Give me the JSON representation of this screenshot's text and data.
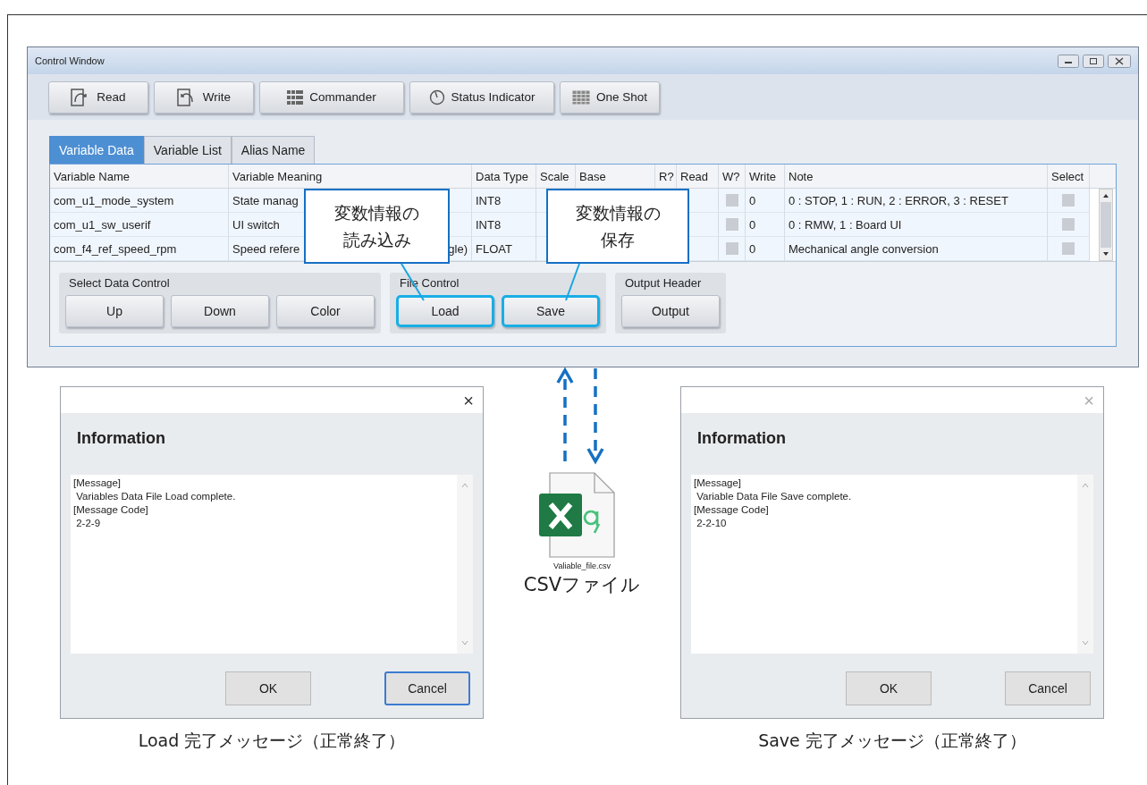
{
  "window": {
    "title": "Control Window",
    "toolbar": [
      {
        "label": "Read"
      },
      {
        "label": "Write"
      },
      {
        "label": "Commander"
      },
      {
        "label": "Status Indicator"
      },
      {
        "label": "One Shot"
      }
    ],
    "tabs": [
      {
        "label": "Variable Data",
        "selected": true
      },
      {
        "label": "Variable List",
        "selected": false
      },
      {
        "label": "Alias Name",
        "selected": false
      }
    ],
    "table": {
      "columns": [
        "Variable Name",
        "Variable Meaning",
        "Data Type",
        "Scale",
        "Base",
        "R?",
        "Read",
        "W?",
        "Write",
        "Note",
        "Select"
      ],
      "rows": [
        {
          "variable_name": "com_u1_mode_system",
          "meaning": "State manag",
          "data_type": "INT8",
          "w_checked": false,
          "write": "0",
          "note": "0 : STOP, 1 : RUN, 2 : ERROR, 3 : RESET",
          "select": false
        },
        {
          "variable_name": "com_u1_sw_userif",
          "meaning": "UI switch",
          "data_type": "INT8",
          "w_checked": false,
          "write": "0",
          "note": "0 : RMW, 1 : Board UI",
          "select": false
        },
        {
          "variable_name": "com_f4_ref_speed_rpm",
          "meaning": "Speed refere",
          "meaning_tail": "gle)",
          "data_type": "FLOAT",
          "w_checked": false,
          "write": "0",
          "note": "Mechanical angle conversion",
          "select": false
        }
      ]
    },
    "groups": [
      {
        "title": "Select Data Control",
        "buttons": [
          {
            "label": "Up",
            "highlighted": false
          },
          {
            "label": "Down",
            "highlighted": false
          },
          {
            "label": "Color",
            "highlighted": false
          }
        ]
      },
      {
        "title": "File Control",
        "buttons": [
          {
            "label": "Load",
            "highlighted": true
          },
          {
            "label": "Save",
            "highlighted": true
          }
        ]
      },
      {
        "title": "Output Header",
        "buttons": [
          {
            "label": "Output",
            "highlighted": false
          }
        ]
      }
    ]
  },
  "callouts": [
    {
      "lines": [
        "変数情報の",
        "読み込み"
      ]
    },
    {
      "lines": [
        "変数情報の",
        "保存"
      ]
    }
  ],
  "file": {
    "name": "Valiable_file.csv",
    "label": "CSVファイル"
  },
  "dialogs": [
    {
      "close": "×",
      "title": "Information",
      "message_lines": [
        "[Message]",
        " Variables Data File Load complete.",
        "[Message Code]",
        " 2-2-9"
      ],
      "buttons": [
        {
          "label": "OK",
          "focused": false
        },
        {
          "label": "Cancel",
          "focused": true
        }
      ],
      "caption": "Load 完了メッセージ（正常終了）"
    },
    {
      "close": "×",
      "title": "Information",
      "message_lines": [
        "[Message]",
        " Variable Data File Save complete.",
        "[Message Code]",
        " 2-2-10"
      ],
      "buttons": [
        {
          "label": "OK",
          "focused": false
        },
        {
          "label": "Cancel",
          "focused": false
        }
      ],
      "caption": "Save 完了メッセージ（正常終了）"
    }
  ]
}
